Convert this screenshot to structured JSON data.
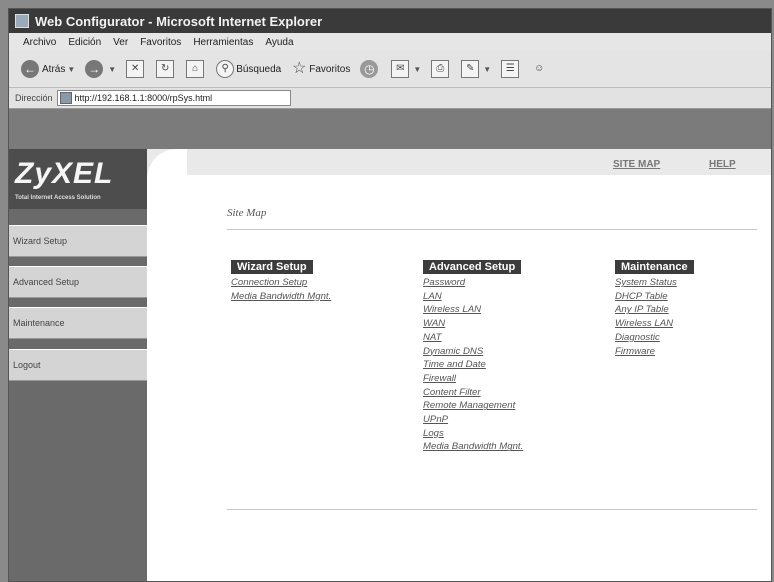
{
  "window": {
    "title": "Web Configurator - Microsoft Internet Explorer"
  },
  "menu": [
    "Archivo",
    "Edición",
    "Ver",
    "Favoritos",
    "Herramientas",
    "Ayuda"
  ],
  "toolbar": {
    "back_label": "Atrás",
    "search_label": "Búsqueda",
    "favorites_label": "Favoritos"
  },
  "address": {
    "label": "Dirección",
    "url": "http://192.168.1.1:8000/rpSys.html"
  },
  "brand": {
    "logo": "ZyXEL",
    "tagline": "Total Internet Access Solution"
  },
  "sidebar": {
    "items": [
      "Wizard Setup",
      "Advanced Setup",
      "Maintenance",
      "Logout"
    ]
  },
  "header_links": {
    "site_map": "SITE MAP",
    "help": "HELP"
  },
  "page": {
    "title": "Site Map"
  },
  "columns": [
    {
      "heading": "Wizard Setup",
      "links": [
        "Connection Setup",
        "Media Bandwidth Mgnt."
      ]
    },
    {
      "heading": "Advanced Setup",
      "links": [
        "Password",
        "LAN",
        "Wireless LAN",
        "WAN",
        "NAT",
        "Dynamic DNS",
        "Time and Date",
        "Firewall",
        "Content Filter",
        "Remote Management",
        "UPnP",
        "Logs",
        "Media Bandwidth Mgnt."
      ]
    },
    {
      "heading": "Maintenance",
      "links": [
        "System Status",
        "DHCP Table",
        "Any IP Table",
        "Wireless LAN",
        "Diagnostic",
        "Firmware"
      ]
    }
  ]
}
